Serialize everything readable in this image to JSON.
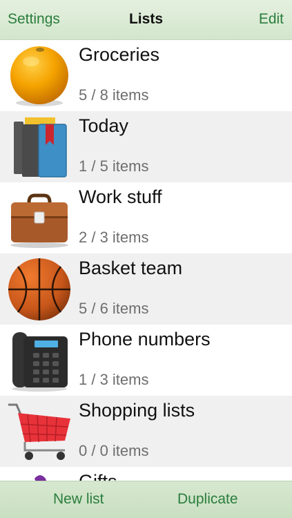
{
  "navbar": {
    "left_button": "Settings",
    "title": "Lists",
    "right_button": "Edit"
  },
  "lists": [
    {
      "title": "Groceries",
      "count": "5 / 8 items",
      "icon": "orange-icon"
    },
    {
      "title": "Today",
      "count": "1 / 5 items",
      "icon": "books-icon"
    },
    {
      "title": "Work stuff",
      "count": "2 / 3 items",
      "icon": "briefcase-icon"
    },
    {
      "title": "Basket team",
      "count": "5 / 6 items",
      "icon": "basketball-icon"
    },
    {
      "title": "Phone numbers",
      "count": "1 / 3 items",
      "icon": "telephone-icon"
    },
    {
      "title": "Shopping lists",
      "count": "0 / 0 items",
      "icon": "shopping-cart-icon"
    },
    {
      "title": "Gifts",
      "count": "",
      "icon": "gift-icon"
    }
  ],
  "toolbar": {
    "new_label": "New list",
    "duplicate_label": "Duplicate"
  },
  "colors": {
    "accent": "#2a7d3c",
    "bar": "#d3e6cc",
    "row_alt": "#f0f0f0"
  }
}
